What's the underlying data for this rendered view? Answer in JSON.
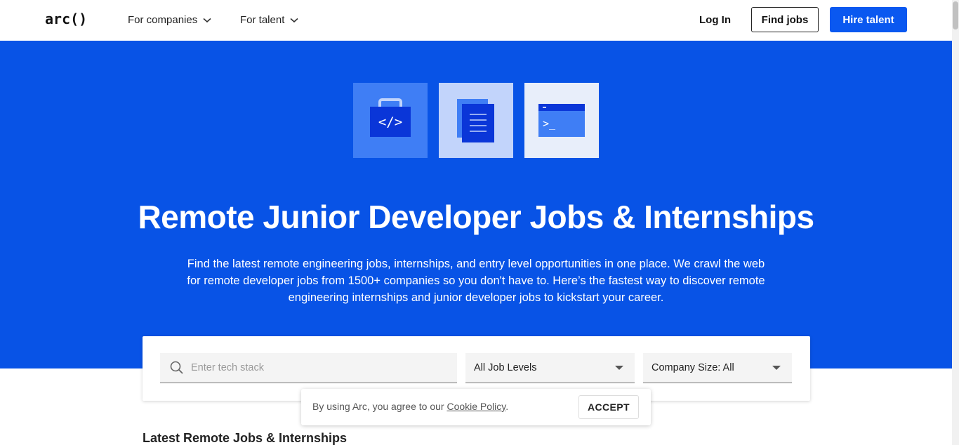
{
  "header": {
    "logo": "arc()",
    "nav": [
      {
        "label": "For companies"
      },
      {
        "label": "For talent"
      }
    ],
    "login_label": "Log In",
    "find_jobs_label": "Find jobs",
    "hire_talent_label": "Hire talent"
  },
  "hero": {
    "icons": [
      "code-briefcase-icon",
      "document-icon",
      "terminal-icon"
    ],
    "code_glyph": "</>",
    "terminal_glyph": ">_",
    "title": "Remote Junior Developer Jobs & Internships",
    "subtitle": "Find the latest remote engineering jobs, internships, and entry level opportunities in one place. We crawl the web for remote developer jobs from 1500+ companies so you don't have to. Here’s the fastest way to discover remote engineering internships and junior developer jobs to kickstart your career."
  },
  "search": {
    "placeholder": "Enter tech stack",
    "value": "",
    "job_level": "All Job Levels",
    "company_size": "Company Size: All"
  },
  "cookie": {
    "text": "By using Arc, you agree to our ",
    "link": "Cookie Policy",
    "after": ".",
    "accept_label": "ACCEPT"
  },
  "section": {
    "title": "Latest Remote Jobs & Internships"
  },
  "colors": {
    "brand_blue": "#0853e6",
    "button_blue": "#0a58f0"
  }
}
